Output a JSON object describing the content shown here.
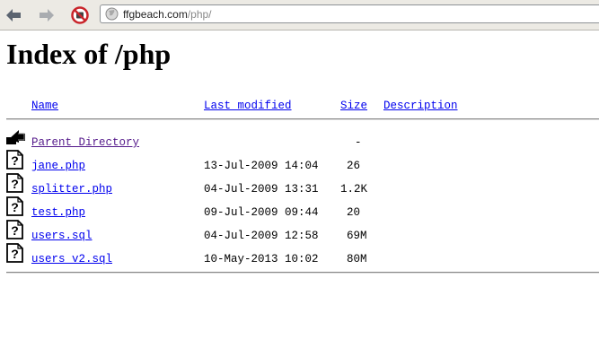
{
  "browser": {
    "url_domain": "ffgbeach.com",
    "url_path": "/php/"
  },
  "page": {
    "title": "Index of /php"
  },
  "columns": {
    "name": "Name",
    "last_modified": "Last modified",
    "size": "Size",
    "description": "Description"
  },
  "parent": {
    "label": "Parent Directory",
    "size": "-"
  },
  "files": [
    {
      "name": "jane.php",
      "modified": "13-Jul-2009 14:04",
      "size": "26"
    },
    {
      "name": "splitter.php",
      "modified": "04-Jul-2009 13:31",
      "size": "1.2K"
    },
    {
      "name": "test.php",
      "modified": "09-Jul-2009 09:44",
      "size": "20"
    },
    {
      "name": "users.sql",
      "modified": "04-Jul-2009 12:58",
      "size": "69M"
    },
    {
      "name": "users_v2.sql",
      "modified": "10-May-2013 10:02",
      "size": "80M"
    }
  ],
  "icons": {
    "back": "back-arrow-icon",
    "forward": "forward-arrow-icon",
    "stop": "stop-icon",
    "site": "globe-icon",
    "parent": "parent-directory-icon",
    "file": "unknown-file-icon"
  },
  "colors": {
    "link": "#0000ee",
    "visited": "#551a8b",
    "toolbar": "#eceae4"
  }
}
